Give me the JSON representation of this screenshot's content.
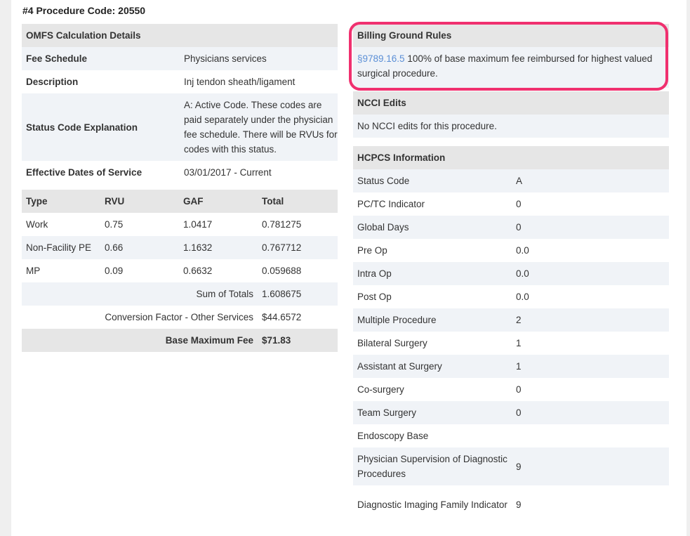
{
  "page_title": "#4 Procedure Code: 20550",
  "omfs": {
    "header": "OMFS Calculation Details",
    "rows": [
      {
        "label": "Fee Schedule",
        "value": "Physicians services"
      },
      {
        "label": "Description",
        "value": "Inj tendon sheath/ligament"
      },
      {
        "label": "Status Code Explanation",
        "value": "A: Active Code. These codes are paid separately under the physician fee schedule. There will be RVUs for codes with this status."
      },
      {
        "label": "Effective Dates of Service",
        "value": "03/01/2017 - Current"
      }
    ]
  },
  "rvu_table": {
    "columns": [
      "Type",
      "RVU",
      "GAF",
      "Total"
    ],
    "rows": [
      [
        "Work",
        "0.75",
        "1.0417",
        "0.781275"
      ],
      [
        "Non-Facility PE",
        "0.66",
        "1.1632",
        "0.767712"
      ],
      [
        "MP",
        "0.09",
        "0.6632",
        "0.059688"
      ]
    ],
    "sum_label": "Sum of Totals",
    "sum_value": "1.608675",
    "conversion_label": "Conversion Factor - Other Services",
    "conversion_value": "$44.6572",
    "base_label": "Base Maximum Fee",
    "base_value": "$71.83"
  },
  "billing": {
    "header": "Billing Ground Rules",
    "link_text": "§9789.16.5",
    "text": " 100% of base maximum fee reimbursed for highest valued surgical procedure.",
    "highlight_color": "#f0306f"
  },
  "ncci": {
    "header": "NCCI Edits",
    "text": "No NCCI edits for this procedure."
  },
  "hcpcs": {
    "header": "HCPCS Information",
    "rows": [
      {
        "label": "Status Code",
        "value": "A"
      },
      {
        "label": "PC/TC Indicator",
        "value": "0"
      },
      {
        "label": "Global Days",
        "value": "0"
      },
      {
        "label": "Pre Op",
        "value": "0.0"
      },
      {
        "label": "Intra Op",
        "value": "0.0"
      },
      {
        "label": "Post Op",
        "value": "0.0"
      },
      {
        "label": "Multiple Procedure",
        "value": "2"
      },
      {
        "label": "Bilateral Surgery",
        "value": "1"
      },
      {
        "label": "Assistant at Surgery",
        "value": "1"
      },
      {
        "label": "Co-surgery",
        "value": "0"
      },
      {
        "label": "Team Surgery",
        "value": "0"
      },
      {
        "label": "Endoscopy Base",
        "value": ""
      },
      {
        "label": "Physician Supervision of Diagnostic Procedures",
        "value": "9"
      },
      {
        "label": "Diagnostic Imaging Family Indicator",
        "value": "9"
      }
    ]
  }
}
